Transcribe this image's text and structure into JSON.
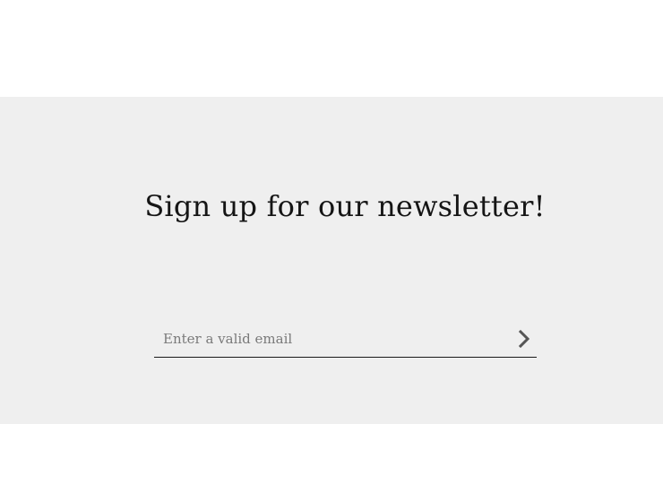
{
  "newsletter": {
    "title": "Sign up for our newsletter!",
    "email_placeholder": "Enter a valid email",
    "email_value": "",
    "submit_icon": "chevron-right-icon"
  },
  "colors": {
    "section_background": "#efefef",
    "page_background": "#ffffff",
    "title_text": "#151515",
    "icon": "#555555"
  }
}
